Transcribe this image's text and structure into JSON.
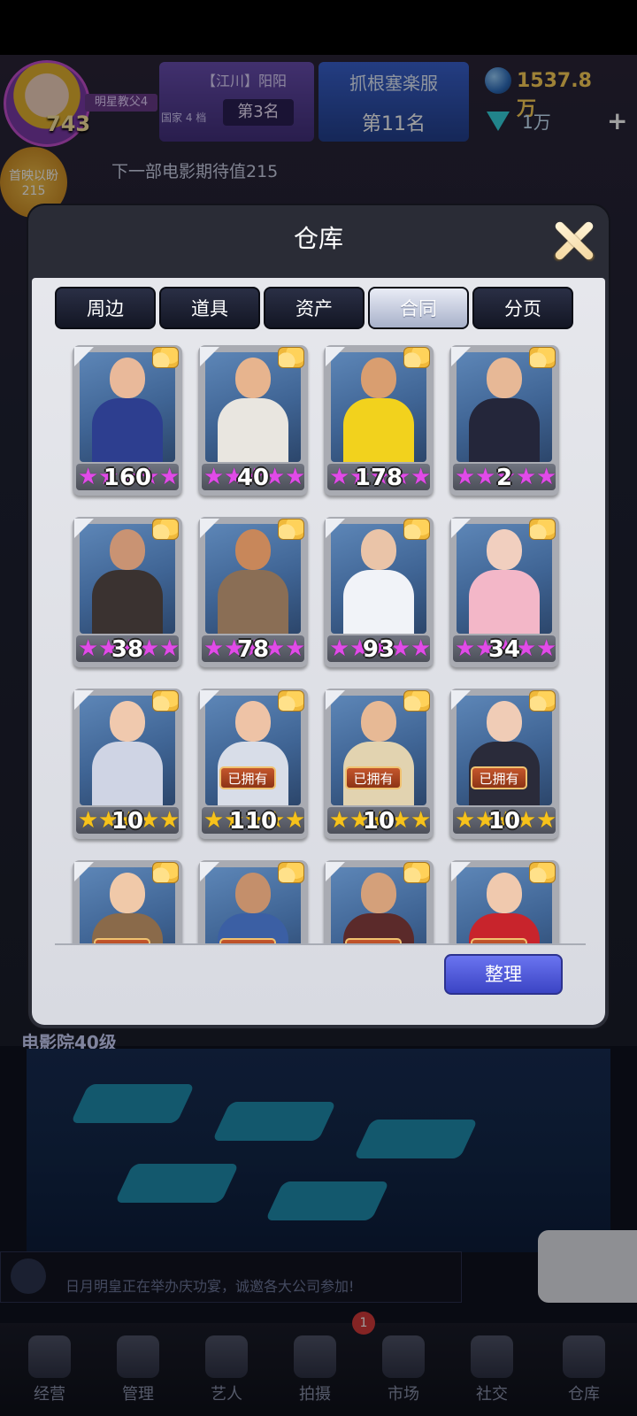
{
  "hud": {
    "avatar_title": "明星教父4",
    "avatar_level": "743",
    "server_name": "【江川】阳阳",
    "country_level": "国家 4 档",
    "server_rank": "第3名",
    "alliance_name": "抓根塞楽服",
    "alliance_rank": "第11名",
    "money": "1537.8万",
    "diamonds": "1万",
    "premiere_label": "首映以盼",
    "premiere_value": "215",
    "expectation_text": "下一部电影期待值215",
    "cinema_level": "电影院40级"
  },
  "news": {
    "text": "日月明皇正在举办庆功宴，诚邀各大公司参加!"
  },
  "bottom_nav": {
    "items": [
      {
        "label": "经营"
      },
      {
        "label": "管理"
      },
      {
        "label": "艺人"
      },
      {
        "label": "拍摄"
      },
      {
        "label": "市场"
      },
      {
        "label": "社交"
      },
      {
        "label": "仓库"
      }
    ],
    "badge": "1"
  },
  "modal": {
    "title": "仓库",
    "tabs": [
      {
        "label": "周边",
        "active": false
      },
      {
        "label": "道具",
        "active": false
      },
      {
        "label": "资产",
        "active": false
      },
      {
        "label": "合同",
        "active": true
      },
      {
        "label": "分页",
        "active": false
      }
    ],
    "owned_label": "已拥有",
    "sort_button": "整理",
    "cards": [
      {
        "count": "160",
        "star_color": "pink",
        "owned": false,
        "skin": "#e9b99a",
        "outfit": "#2d3e8f"
      },
      {
        "count": "40",
        "star_color": "pink",
        "owned": false,
        "skin": "#e7b48e",
        "outfit": "#e9e6e0"
      },
      {
        "count": "178",
        "star_color": "pink",
        "owned": false,
        "skin": "#d99e70",
        "outfit": "#f2d21d"
      },
      {
        "count": "2",
        "star_color": "pink",
        "owned": false,
        "skin": "#e7b896",
        "outfit": "#24263a"
      },
      {
        "count": "38",
        "star_color": "pink",
        "owned": false,
        "skin": "#c99373",
        "outfit": "#3a3230"
      },
      {
        "count": "78",
        "star_color": "pink",
        "owned": false,
        "skin": "#c8875a",
        "outfit": "#8a6e55"
      },
      {
        "count": "93",
        "star_color": "pink",
        "owned": false,
        "skin": "#eac4a8",
        "outfit": "#f1f3f8"
      },
      {
        "count": "34",
        "star_color": "pink",
        "owned": false,
        "skin": "#f1cfbf",
        "outfit": "#f3b7c8"
      },
      {
        "count": "10",
        "star_color": "gold",
        "owned": false,
        "skin": "#f0c9ae",
        "outfit": "#cfd4e4"
      },
      {
        "count": "110",
        "star_color": "gold",
        "owned": true,
        "skin": "#eec3a6",
        "outfit": "#d8dde8"
      },
      {
        "count": "10",
        "star_color": "gold",
        "owned": true,
        "skin": "#e7b995",
        "outfit": "#e2d3b0"
      },
      {
        "count": "10",
        "star_color": "gold",
        "owned": true,
        "skin": "#f0ccb6",
        "outfit": "#2a2b3a"
      },
      {
        "count": "",
        "star_color": "gold",
        "owned": true,
        "skin": "#f0c9a9",
        "outfit": "#8a6a4a"
      },
      {
        "count": "",
        "star_color": "gold",
        "owned": true,
        "skin": "#c48f6b",
        "outfit": "#3b5fa4"
      },
      {
        "count": "",
        "star_color": "gold",
        "owned": true,
        "skin": "#d4a07a",
        "outfit": "#5b2a2a"
      },
      {
        "count": "",
        "star_color": "gold",
        "owned": true,
        "skin": "#f0c9ae",
        "outfit": "#c8242c"
      }
    ]
  }
}
